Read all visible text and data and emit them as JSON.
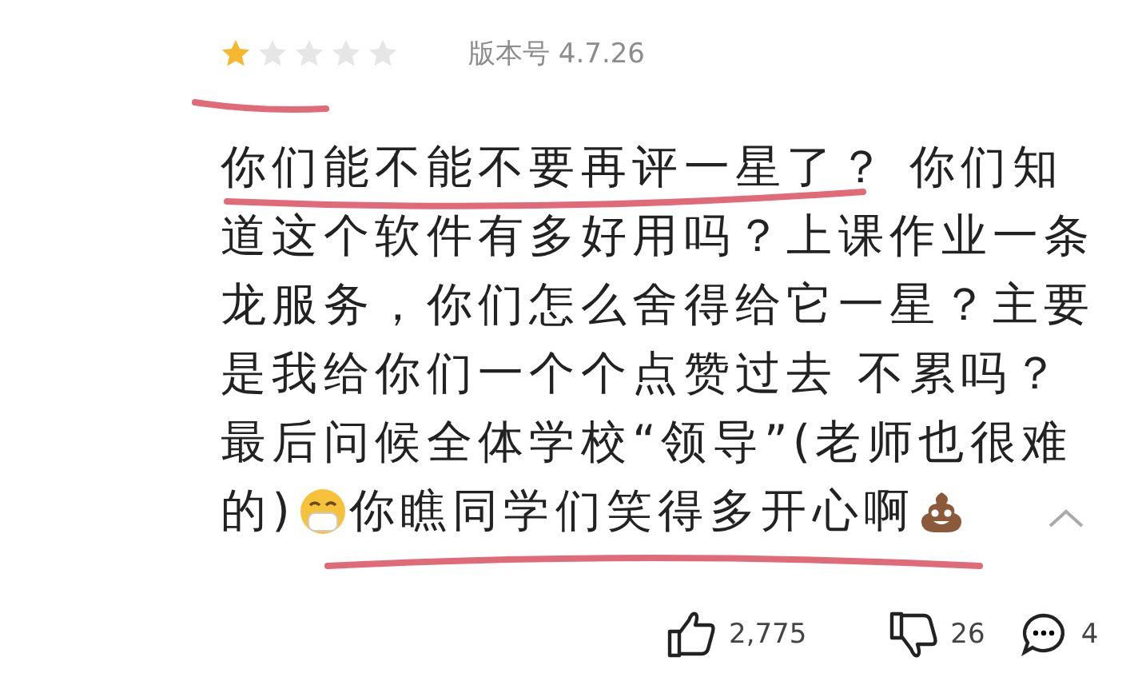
{
  "review": {
    "stars": 1,
    "version": "版本号 4.7.26",
    "lines": [
      [
        {
          "kind": "text",
          "text": "你们能不能不要再评一星了？ 你们知"
        }
      ],
      [
        {
          "kind": "text",
          "text": "道这个软件有多好用吗？上课作业一条"
        }
      ],
      [
        {
          "kind": "text",
          "text": "龙服务，你们怎么舍得给它一星？主要"
        }
      ],
      [
        {
          "kind": "text",
          "text": "是我给你们一个个点赞过去 不累吗？"
        }
      ],
      [
        {
          "kind": "text",
          "text": "最后问候全体学校“领导”(老师也很难"
        }
      ],
      [
        {
          "kind": "text",
          "text": "的)"
        },
        {
          "kind": "mask_emoji"
        },
        {
          "kind": "text",
          "text": "你瞧同学们笑得多开心啊"
        },
        {
          "kind": "poop_emoji"
        }
      ]
    ],
    "expanded": true,
    "likes": "2,775",
    "dislikes": "26",
    "comments": "4"
  }
}
